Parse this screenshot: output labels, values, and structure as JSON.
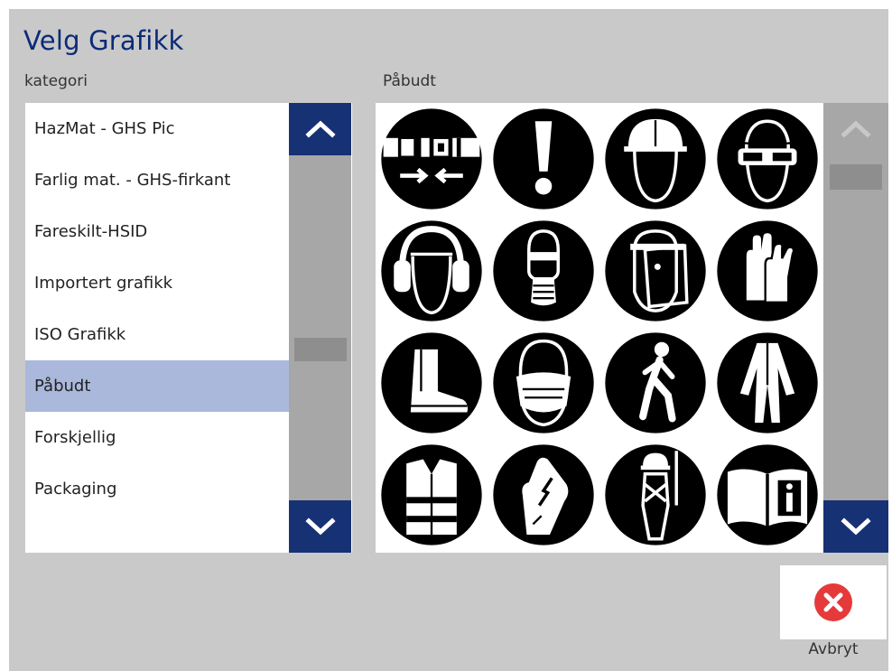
{
  "window": {
    "title": "Velg Grafikk"
  },
  "category": {
    "label": "kategori",
    "items": [
      "HazMat - GHS Pic",
      "Farlig mat. - GHS-firkant",
      "Fareskilt-HSID",
      "Importert grafikk",
      "ISO Grafikk",
      "Påbudt",
      "Forskjellig",
      "Packaging"
    ],
    "selected": "Påbudt"
  },
  "graphics": {
    "label": "Påbudt",
    "icons": [
      "seatbelt-icon",
      "exclamation-icon",
      "hard-hat-icon",
      "safety-goggles-icon",
      "ear-protection-icon",
      "respirator-icon",
      "face-shield-icon",
      "gloves-icon",
      "safety-boots-icon",
      "dust-mask-icon",
      "pedestrian-icon",
      "protective-suit-icon",
      "hi-vis-vest-icon",
      "insulated-gloves-icon",
      "harness-icon",
      "read-manual-icon"
    ]
  },
  "actions": {
    "cancel_label": "Avbryt",
    "cancel_icon": "close-icon",
    "cancel_color": "#e63a3a"
  },
  "colors": {
    "accent": "#173175",
    "title": "#0b2a78",
    "selection": "#aab8dc",
    "background": "#c9c9c9"
  }
}
